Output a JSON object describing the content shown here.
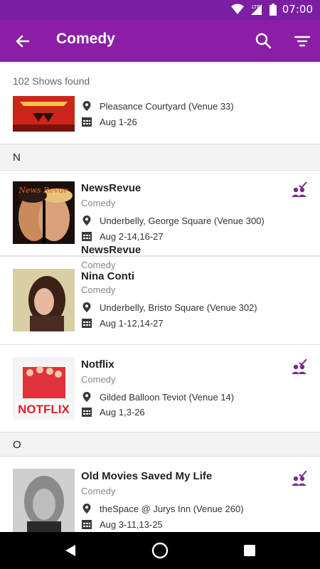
{
  "status_bar": {
    "time": "07:00",
    "network": "LTE"
  },
  "app_bar": {
    "title": "Comedy"
  },
  "results": {
    "count_text": "102 Shows found"
  },
  "sections": [
    {
      "letter": "N"
    },
    {
      "letter": "O"
    }
  ],
  "shows": [
    {
      "name": "",
      "genre": "",
      "venue": "Pleasance Courtyard (Venue 33)",
      "dates": "Aug 1-26",
      "booked": false
    },
    {
      "name": "NewsRevue",
      "genre": "Comedy",
      "venue": "Underbelly, George Square (Venue 300)",
      "dates": "Aug 2-14,16-27",
      "booked": true,
      "thumb_text": "News Revue"
    },
    {
      "name": "Nina Conti",
      "genre": "Comedy",
      "venue": "Underbelly, Bristo Square (Venue 302)",
      "dates": "Aug 1-12,14-27",
      "booked": false
    },
    {
      "name": "Notflix",
      "genre": "Comedy",
      "venue": "Gilded Balloon Teviot (Venue 14)",
      "dates": "Aug 1,3-26",
      "booked": true,
      "thumb_text": "NOTFLIX"
    },
    {
      "name": "Old Movies Saved My Life",
      "genre": "Comedy",
      "venue": "theSpace @ Jurys Inn (Venue 260)",
      "dates": "Aug 3-11,13-25",
      "booked": true
    }
  ],
  "colors": {
    "primary": "#8a1fa6",
    "status": "#7b1fa2",
    "accent": "#7b2a8c"
  },
  "icons": [
    "back-arrow-icon",
    "search-icon",
    "filter-icon",
    "location-pin-icon",
    "calendar-icon",
    "booked-audience-icon",
    "nav-back-icon",
    "nav-home-icon",
    "nav-recents-icon"
  ]
}
